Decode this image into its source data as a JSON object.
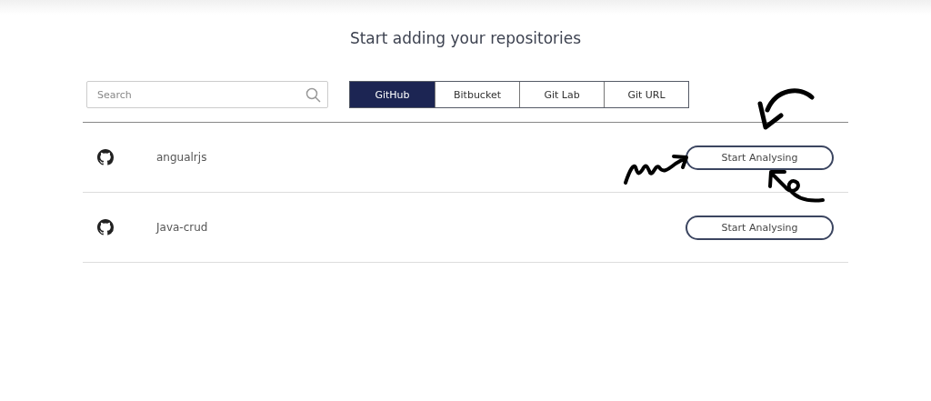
{
  "title": "Start adding your repositories",
  "search": {
    "placeholder": "Search"
  },
  "tabs": [
    {
      "label": "GitHub",
      "selected": true
    },
    {
      "label": "Bitbucket",
      "selected": false
    },
    {
      "label": "Git Lab",
      "selected": false
    },
    {
      "label": "Git URL",
      "selected": false
    }
  ],
  "repositories": [
    {
      "name": "angualrjs",
      "button": "Start Analysing"
    },
    {
      "name": "Java-crud",
      "button": "Start Analysing"
    }
  ]
}
